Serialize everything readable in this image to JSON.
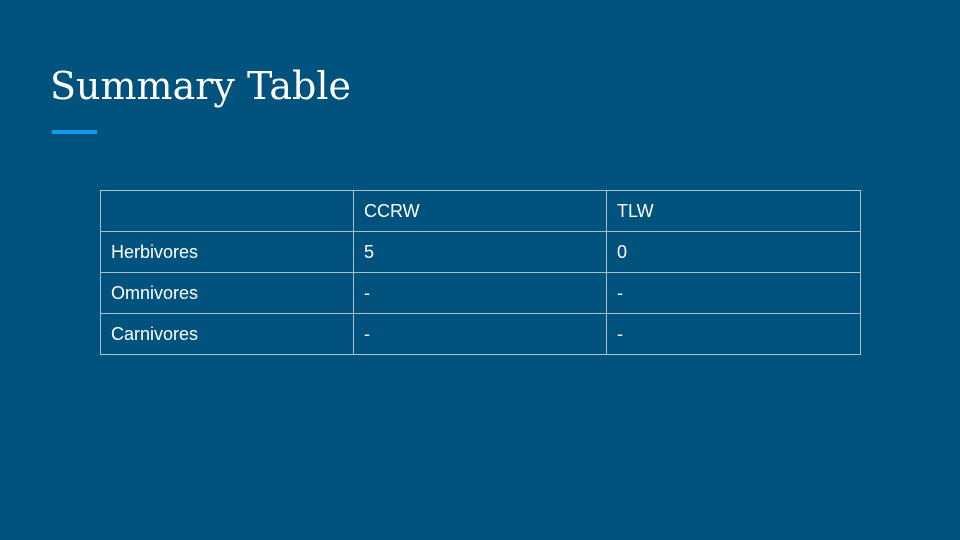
{
  "slide": {
    "title": "Summary Table",
    "background_color": "#01527c",
    "accent_color": "#0e9ce6"
  },
  "table": {
    "header": [
      "",
      "CCRW",
      "TLW"
    ],
    "rows": [
      [
        "Herbivores",
        "5",
        "0"
      ],
      [
        "Omnivores",
        "-",
        "-"
      ],
      [
        "Carnivores",
        "-",
        "-"
      ]
    ]
  }
}
